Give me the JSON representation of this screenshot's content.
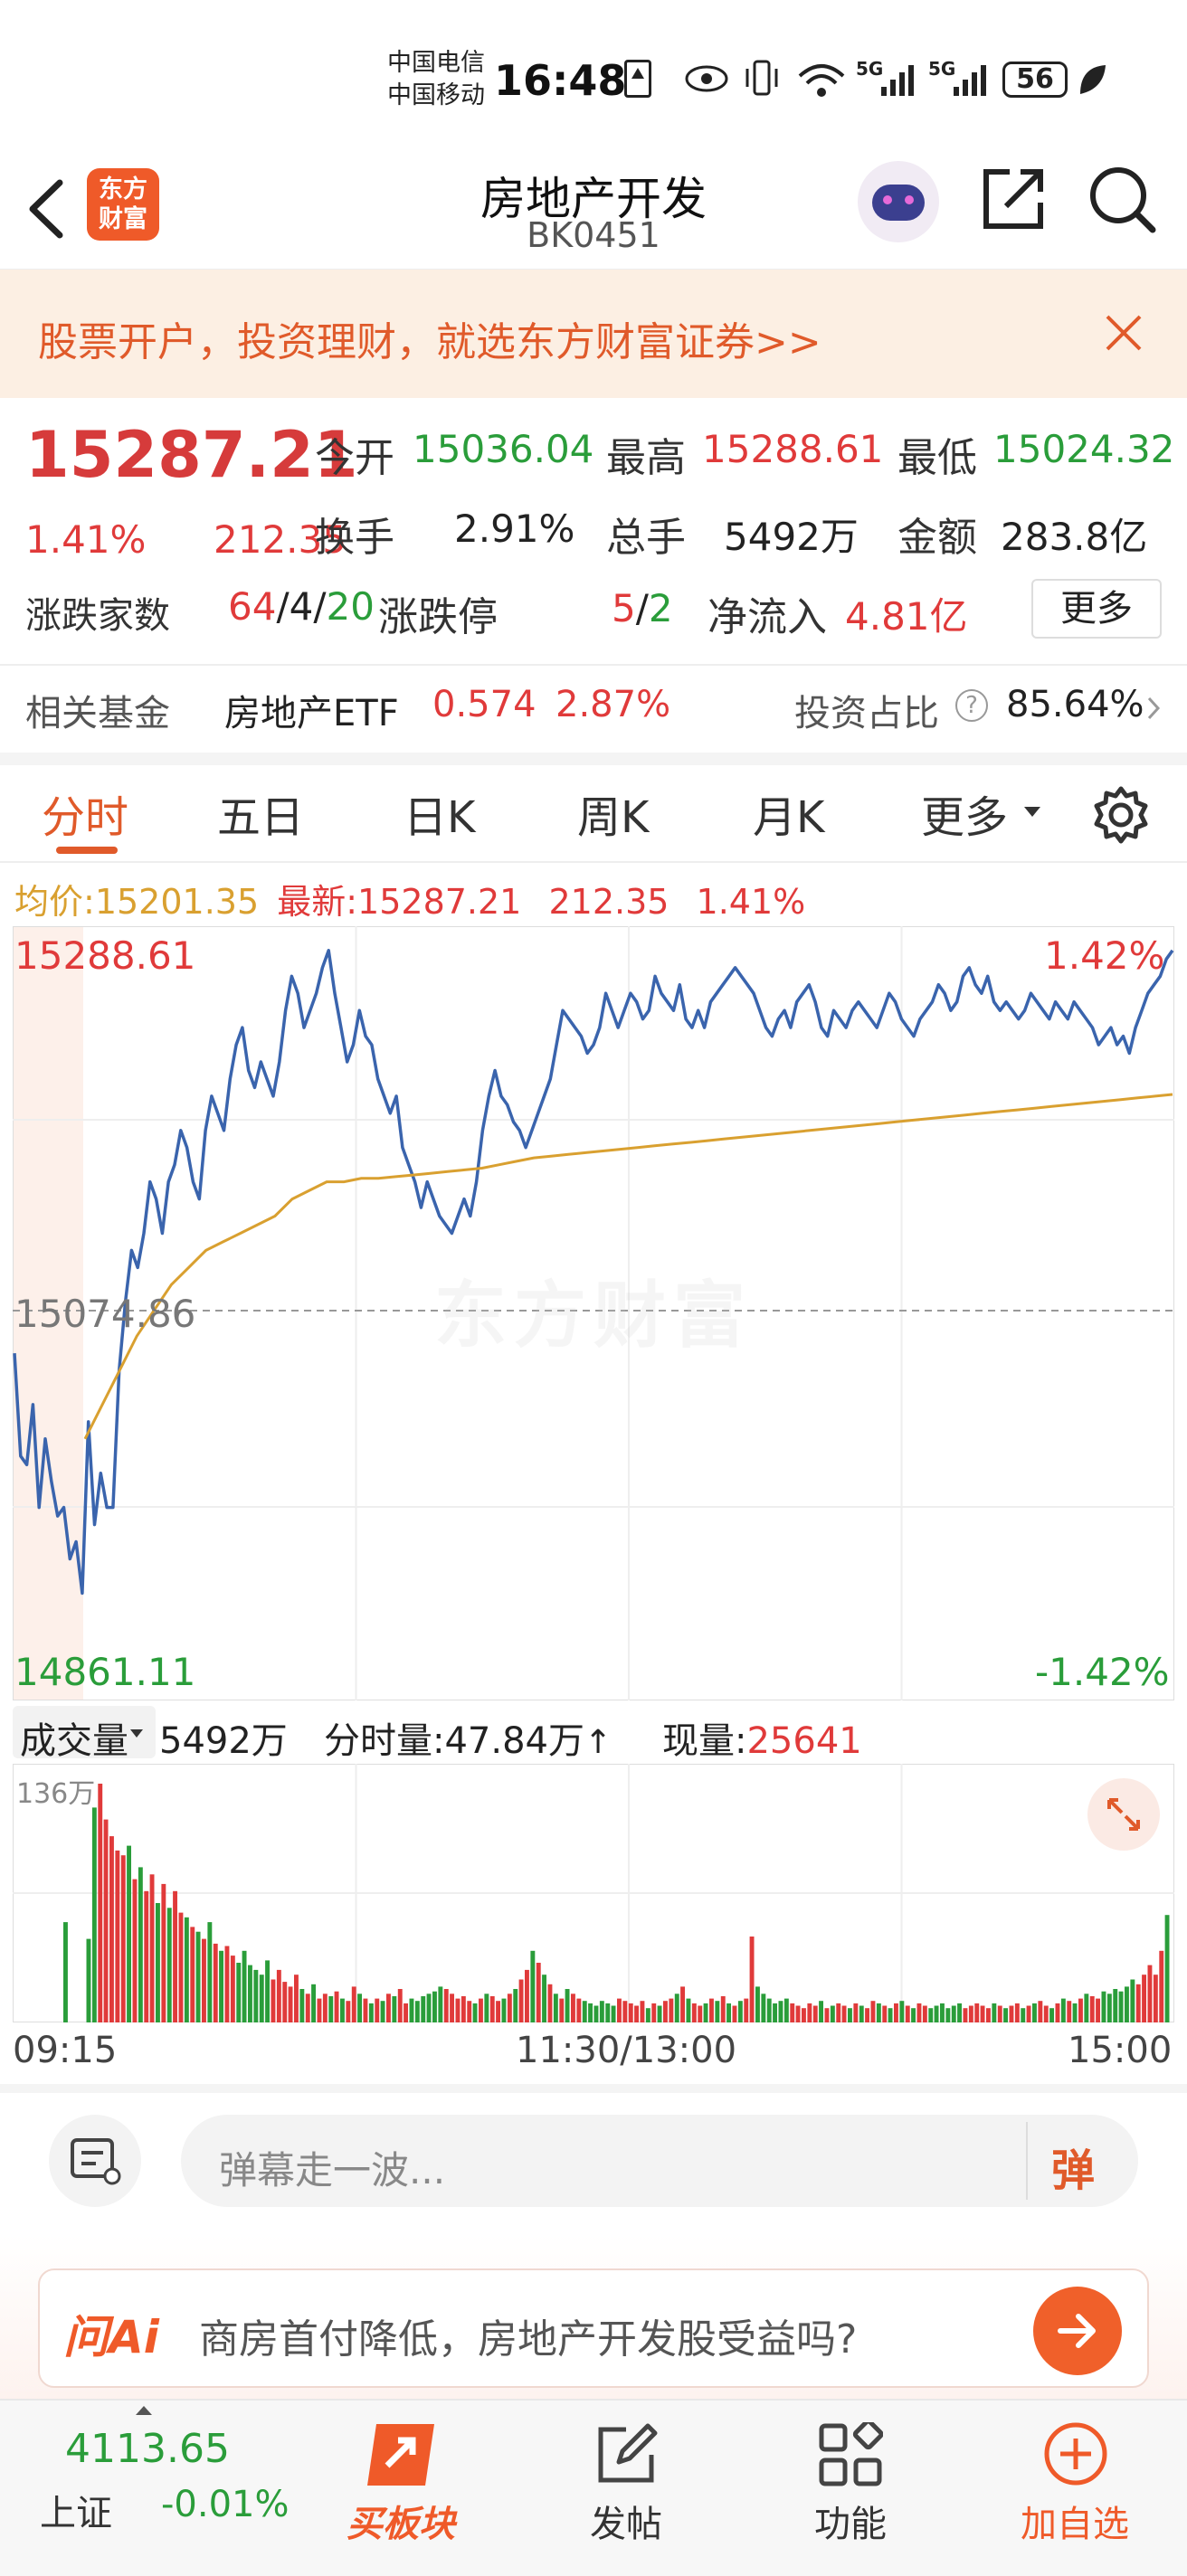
{
  "status_bar": {
    "carrier1": "中国电信",
    "carrier2": "中国移动",
    "time": "16:48",
    "net1": "5G",
    "net2": "5G",
    "battery": "56"
  },
  "nav": {
    "back_icon": "back-arrow-icon",
    "logo_text": "东方财富",
    "title": "房地产开发",
    "code": "BK0451"
  },
  "banner": {
    "text": "股票开户，投资理财，就选东方财富证券>>"
  },
  "quote": {
    "price": "15287.21",
    "change_pct": "1.41%",
    "change": "212.35",
    "open_label": "今开",
    "open": "15036.04",
    "high_label": "最高",
    "high": "15288.61",
    "low_label": "最低",
    "low": "15024.32",
    "turnover_label": "换手",
    "turnover": "2.91%",
    "volume_label": "总手",
    "volume": "5492万",
    "amount_label": "金额",
    "amount": "283.8亿",
    "updown_label": "涨跌家数",
    "up": "64",
    "flat": "4",
    "down": "20",
    "limit_label": "涨跌停",
    "limit_up": "5",
    "limit_down": "2",
    "netflow_label": "净流入",
    "netflow": "4.81亿",
    "more": "更多"
  },
  "fund": {
    "label": "相关基金",
    "name": "房地产ETF",
    "price": "0.574",
    "pct": "2.87%",
    "ratio_label": "投资占比",
    "ratio": "85.64%"
  },
  "tabs": [
    "分时",
    "五日",
    "日K",
    "周K",
    "月K",
    "更多"
  ],
  "chart_info": {
    "avg_label": "均价:",
    "avg": "15201.35",
    "latest_label": "最新:",
    "latest": "15287.21",
    "change": "212.35",
    "pct": "1.41%"
  },
  "chart_data": {
    "type": "line",
    "y_max": "15288.61",
    "y_mid": "15074.86",
    "y_min": "14861.11",
    "pct_max": "1.42%",
    "pct_min": "-1.42%",
    "ylim": [
      14861.11,
      15288.61
    ],
    "watermark": "东方财富",
    "x_ticks": [
      "09:15",
      "11:30/13:00",
      "15:00"
    ],
    "series": [
      {
        "values": [
          15050,
          14990,
          14985,
          15020,
          14960,
          15000,
          14975,
          14955,
          14960,
          14930,
          14940,
          14910,
          15010,
          14950,
          14980,
          14960,
          14960,
          15040,
          15080,
          15110,
          15100,
          15120,
          15150,
          15140,
          15120,
          15150,
          15160,
          15180,
          15170,
          15150,
          15140,
          15180,
          15200,
          15190,
          15180,
          15210,
          15230,
          15240,
          15215,
          15205,
          15220,
          15210,
          15200,
          15220,
          15250,
          15270,
          15260,
          15240,
          15250,
          15260,
          15275,
          15285,
          15260,
          15240,
          15220,
          15230,
          15250,
          15235,
          15230,
          15210,
          15200,
          15190,
          15200,
          15170,
          15160,
          15150,
          15135,
          15150,
          15140,
          15130,
          15125,
          15120,
          15130,
          15140,
          15130,
          15150,
          15180,
          15200,
          15215,
          15200,
          15195,
          15185,
          15180,
          15170,
          15180,
          15190,
          15200,
          15210,
          15230,
          15250,
          15245,
          15240,
          15235,
          15225,
          15230,
          15240,
          15260,
          15250,
          15240,
          15250,
          15260,
          15255,
          15245,
          15250,
          15270,
          15260,
          15255,
          15250,
          15265,
          15245,
          15240,
          15250,
          15240,
          15255,
          15260,
          15265,
          15270,
          15275,
          15270,
          15265,
          15260,
          15250,
          15240,
          15235,
          15245,
          15250,
          15240,
          15255,
          15260,
          15265,
          15255,
          15240,
          15235,
          15250,
          15245,
          15240,
          15250,
          15255,
          15250,
          15245,
          15240,
          15250,
          15260,
          15255,
          15245,
          15240,
          15235,
          15245,
          15250,
          15255,
          15265,
          15260,
          15250,
          15255,
          15270,
          15275,
          15265,
          15260,
          15270,
          15255,
          15250,
          15255,
          15250,
          15245,
          15250,
          15260,
          15255,
          15250,
          15245,
          15255,
          15250,
          15245,
          15255,
          15250,
          15245,
          15240,
          15230,
          15235,
          15240,
          15230,
          15235,
          15225,
          15240,
          15250,
          15260,
          15265,
          15270,
          15280,
          15285
        ]
      },
      {
        "values": [
          15000,
          15020,
          15040,
          15060,
          15075,
          15090,
          15100,
          15110,
          15115,
          15120,
          15125,
          15130,
          15140,
          15145,
          15150,
          15150,
          15152,
          15152,
          15153,
          15154,
          15155,
          15156,
          15157,
          15158,
          15160,
          15162,
          15164,
          15165,
          15166,
          15167,
          15168,
          15169,
          15170,
          15171,
          15172,
          15173,
          15174,
          15175,
          15176,
          15177,
          15178,
          15179,
          15180,
          15181,
          15182,
          15183,
          15184,
          15185,
          15186,
          15187,
          15188,
          15189,
          15190,
          15191,
          15192,
          15193,
          15194,
          15195,
          15196,
          15197,
          15198,
          15199,
          15200,
          15201
        ]
      }
    ]
  },
  "volume": {
    "dropdown": "成交量",
    "total": "5492万",
    "bar_label": "分时量:",
    "bar_value": "47.84万",
    "now_label": "现量:",
    "now_value": "25641",
    "max_label": "136万",
    "values": [
      0.42,
      0,
      0,
      0,
      0.35,
      0.9,
      1,
      0.85,
      0.78,
      0.72,
      0.7,
      0.74,
      0.6,
      0.65,
      0.55,
      0.62,
      0.5,
      0.58,
      0.48,
      0.55,
      0.46,
      0.44,
      0.4,
      0.38,
      0.35,
      0.42,
      0.33,
      0.3,
      0.32,
      0.28,
      0.25,
      0.3,
      0.24,
      0.22,
      0.2,
      0.26,
      0.18,
      0.22,
      0.17,
      0.15,
      0.2,
      0.14,
      0.12,
      0.16,
      0.1,
      0.12,
      0.11,
      0.13,
      0.1,
      0.09,
      0.15,
      0.12,
      0.1,
      0.08,
      0.1,
      0.09,
      0.12,
      0.11,
      0.14,
      0.08,
      0.1,
      0.09,
      0.11,
      0.12,
      0.13,
      0.15,
      0.14,
      0.12,
      0.1,
      0.11,
      0.09,
      0.08,
      0.1,
      0.12,
      0.11,
      0.09,
      0.1,
      0.12,
      0.14,
      0.18,
      0.22,
      0.3,
      0.25,
      0.2,
      0.16,
      0.12,
      0.1,
      0.14,
      0.12,
      0.1,
      0.09,
      0.08,
      0.07,
      0.09,
      0.08,
      0.07,
      0.1,
      0.09,
      0.08,
      0.07,
      0.09,
      0.06,
      0.08,
      0.07,
      0.09,
      0.1,
      0.12,
      0.15,
      0.1,
      0.08,
      0.07,
      0.08,
      0.1,
      0.09,
      0.11,
      0.08,
      0.07,
      0.09,
      0.1,
      0.36,
      0.15,
      0.12,
      0.1,
      0.08,
      0.09,
      0.1,
      0.08,
      0.07,
      0.06,
      0.08,
      0.07,
      0.09,
      0.06,
      0.07,
      0.08,
      0.07,
      0.06,
      0.08,
      0.07,
      0.06,
      0.09,
      0.08,
      0.07,
      0.06,
      0.08,
      0.09,
      0.07,
      0.06,
      0.08,
      0.07,
      0.06,
      0.07,
      0.08,
      0.06,
      0.07,
      0.08,
      0.06,
      0.07,
      0.08,
      0.07,
      0.06,
      0.08,
      0.07,
      0.06,
      0.07,
      0.08,
      0.06,
      0.07,
      0.08,
      0.09,
      0.07,
      0.06,
      0.08,
      0.1,
      0.09,
      0.08,
      0.1,
      0.12,
      0.11,
      0.1,
      0.13,
      0.12,
      0.14,
      0.13,
      0.15,
      0.18,
      0.16,
      0.2,
      0.24,
      0.2,
      0.3,
      0.45
    ],
    "colors": [
      "g",
      "g",
      "g",
      "g",
      "g",
      "g",
      "r",
      "r",
      "r",
      "r",
      "r",
      "g",
      "r",
      "g",
      "r",
      "r",
      "g",
      "r",
      "g",
      "r",
      "r",
      "g",
      "r",
      "g",
      "r",
      "g",
      "r",
      "g",
      "r",
      "r"
    ]
  },
  "comment": {
    "placeholder": "弹幕走一波...",
    "danmu_label": "弹"
  },
  "ai_bar": {
    "logo": "问Ai",
    "question": "商房首付降低，房地产开发股受益吗?"
  },
  "bottom": {
    "index_value": "4113.65",
    "index_name": "上证",
    "index_pct": "-0.01%",
    "buy_label": "买板块",
    "post_label": "发帖",
    "func_label": "功能",
    "add_label": "加自选"
  }
}
